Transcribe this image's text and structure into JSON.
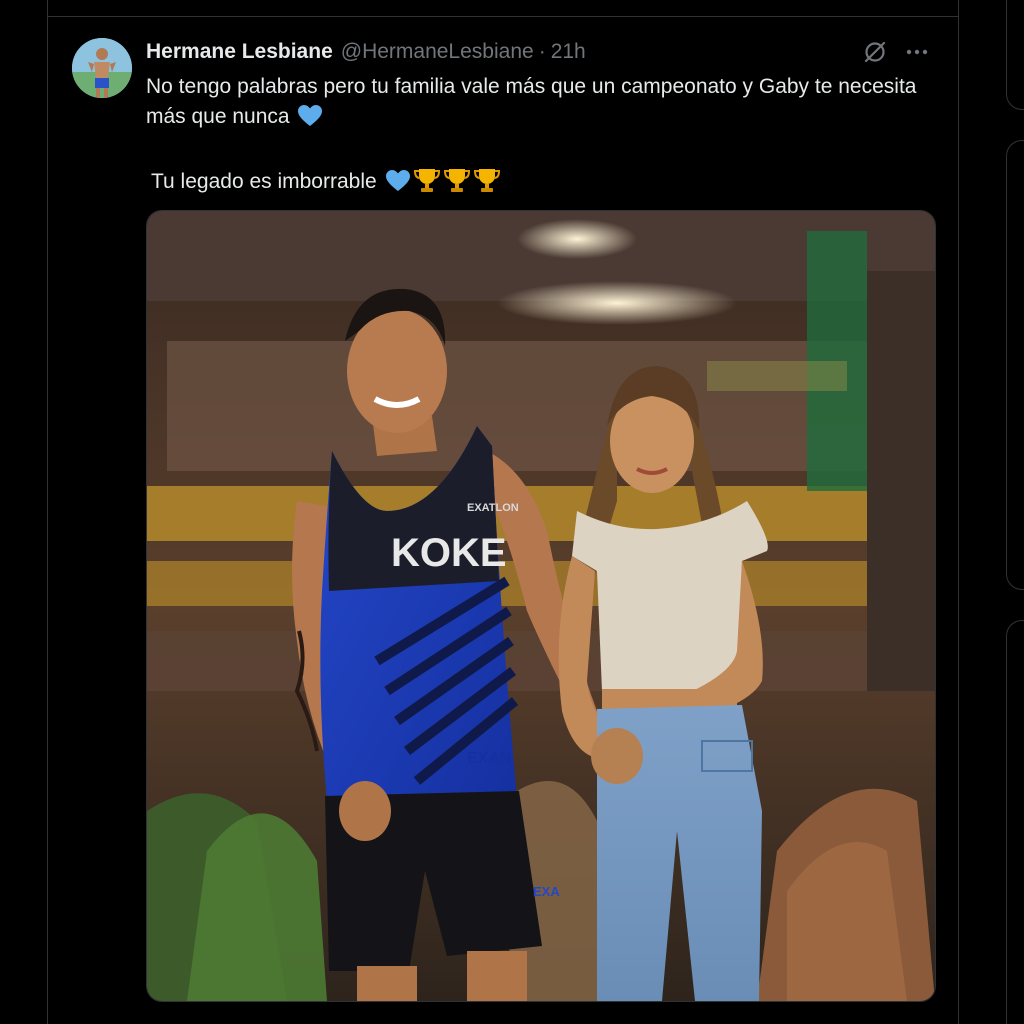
{
  "tweet": {
    "author": {
      "display_name": "Hermane Lesbiane",
      "handle": "@HermaneLesbiane",
      "separator": "·",
      "time": "21h"
    },
    "text": {
      "line1": "No tengo palabras pero tu familia vale más que un campeonato y Gaby te necesita más que nunca",
      "line2": "Tu legado es imborrable"
    },
    "emojis": [
      "blue-heart",
      "trophy",
      "trophy",
      "trophy"
    ],
    "media": {
      "jersey_text": "KOKE",
      "shorts_text": "EXA",
      "jersey_side_text": "EXAN",
      "jersey_badge": "EXATLON"
    }
  },
  "colors": {
    "background": "#000000",
    "border": "#2f3336",
    "text_primary": "#e7e9ea",
    "text_secondary": "#71767b",
    "heart": "#5dadec",
    "trophy": "#f4b400"
  }
}
